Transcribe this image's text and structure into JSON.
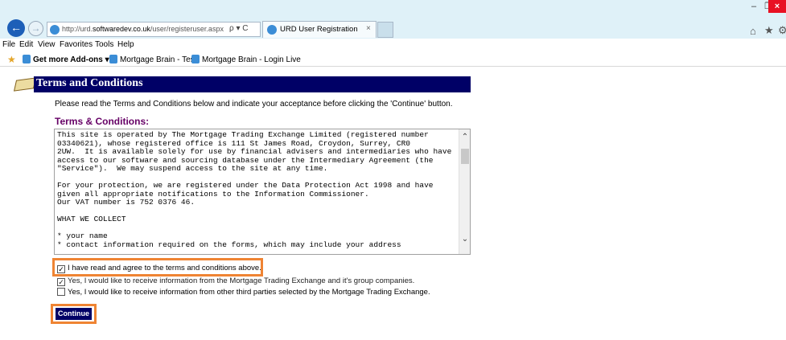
{
  "browser": {
    "address_prefix": "http://urd.",
    "address_host": "softwaredev.co.uk",
    "address_path": "/user/registeruser.aspx",
    "address_actions": "ρ ▾ C",
    "tab_title": "URD User Registration",
    "tab_close": "×",
    "window_controls": {
      "minimize": "–",
      "restore": "❐",
      "close": "×"
    },
    "icons": {
      "back": "back-arrow-icon",
      "forward": "forward-arrow-icon",
      "home": "home-icon",
      "favorites": "star-icon",
      "settings": "gear-icon"
    }
  },
  "menu": [
    "File",
    "Edit",
    "View",
    "Favorites",
    "Tools",
    "Help"
  ],
  "favorites_bar": {
    "items": [
      "Get more Add-ons ▾",
      "Mortgage Brain - Test",
      "Mortgage Brain - Login Live"
    ]
  },
  "page": {
    "title": "Terms and Conditions",
    "instructions": "Please read the Terms and Conditions below and indicate your acceptance before clicking the 'Continue' button.",
    "section_title": "Terms & Conditions:",
    "terms_text": "This site is operated by The Mortgage Trading Exchange Limited (registered number\n03340621), whose registered office is 111 St James Road, Croydon, Surrey, CR0\n2UW.  It is available solely for use by financial advisers and intermediaries who have\naccess to our software and sourcing database under the Intermediary Agreement (the\n\"Service\").  We may suspend access to the site at any time.\n\nFor your protection, we are registered under the Data Protection Act 1998 and have\ngiven all appropriate notifications to the Information Commissioner.\nOur VAT number is 752 0376 46.\n\nWHAT WE COLLECT\n\n* your name\n* contact information required on the forms, which may include your address",
    "checkboxes": [
      {
        "label": "I have read and agree to the terms and conditions above.",
        "checked": true
      },
      {
        "label": "Yes, I would like to receive information from the Mortgage Trading Exchange and it's group companies.",
        "checked": true
      },
      {
        "label": "Yes, I would like to receive information from other third parties selected by the Mortgage Trading Exchange.",
        "checked": false
      }
    ],
    "continue_label": "Continue",
    "highlight_color": "#ef8433",
    "header_color": "#000066",
    "section_title_color": "#660066"
  }
}
